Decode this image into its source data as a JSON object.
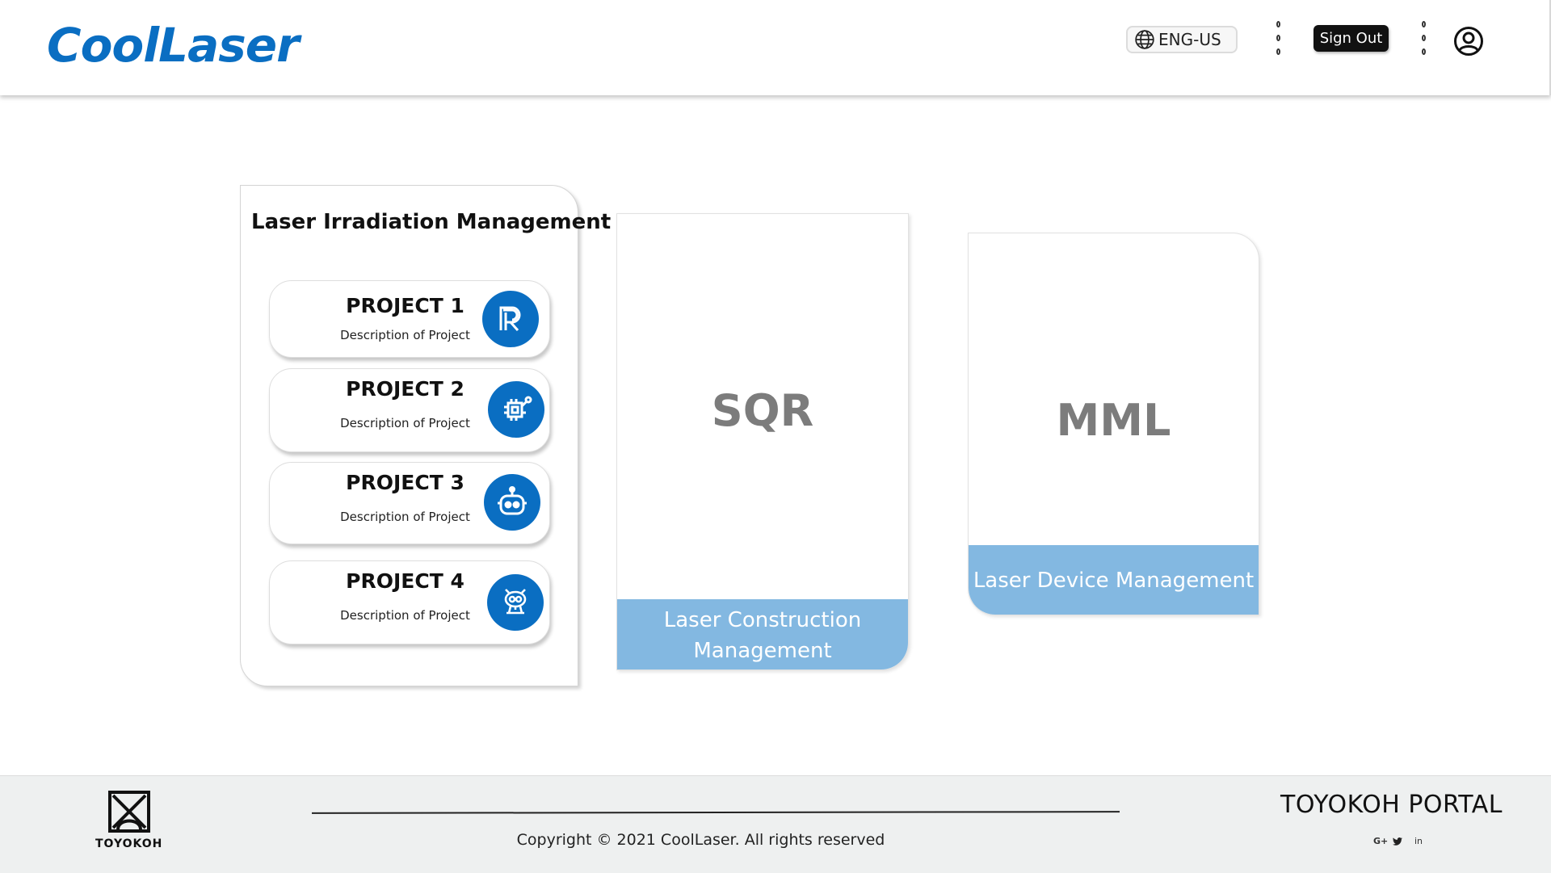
{
  "header": {
    "logo": "CoolLaser",
    "language": "ENG-US",
    "sign_out": "Sign Out"
  },
  "lim_card": {
    "title": "Laser Irradiation Management",
    "projects": [
      {
        "name": "PROJECT 1",
        "description": "Description of Project",
        "icon": "r-logo-icon"
      },
      {
        "name": "PROJECT 2",
        "description": "Description of Project",
        "icon": "circuit-chip-icon"
      },
      {
        "name": "PROJECT 3",
        "description": "Description of Project",
        "icon": "robot-icon"
      },
      {
        "name": "PROJECT 4",
        "description": "Description of Project",
        "icon": "robot-figure-icon"
      }
    ]
  },
  "sqr_card": {
    "label": "SQR",
    "caption": "Laser Construction Management"
  },
  "mml_card": {
    "label": "MML",
    "caption": "Laser Device Management"
  },
  "footer": {
    "brand": "TOYOKOH",
    "copyright": "Copyright ©  2021 CoolLaser. All rights reserved",
    "portal": "TOYOKOH PORTAL",
    "social": [
      "G+",
      "twitter",
      "in"
    ]
  },
  "colors": {
    "brand_blue": "#0a6ec2",
    "caption_band": "#83b8e1",
    "footer_bg": "#eef0f0"
  }
}
